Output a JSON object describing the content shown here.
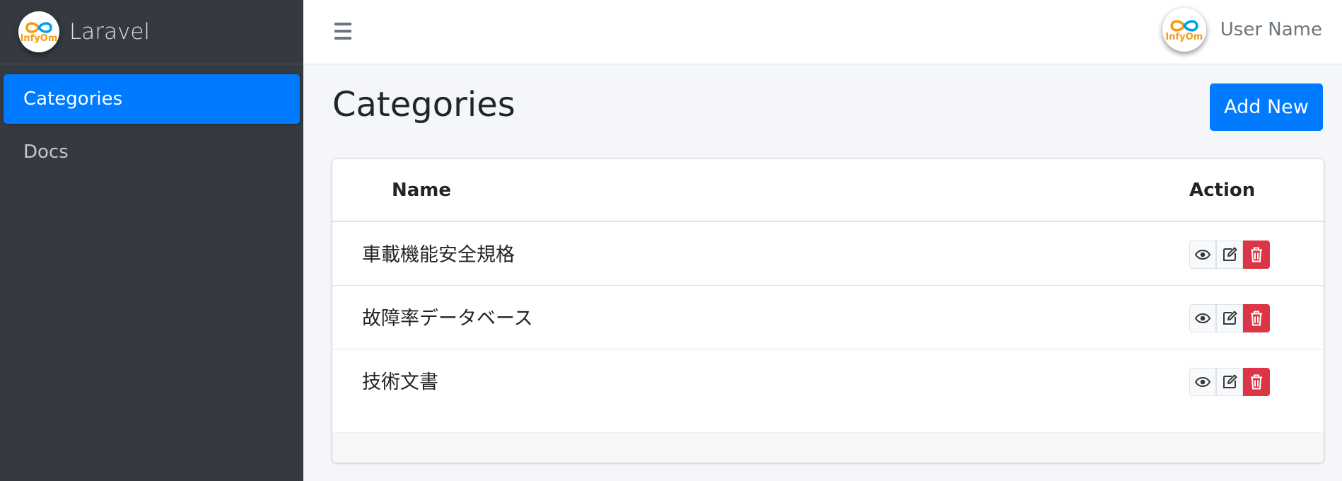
{
  "brand": {
    "name": "Laravel",
    "logo_text": "InfyOm"
  },
  "sidebar": {
    "items": [
      {
        "label": "Categories",
        "active": true
      },
      {
        "label": "Docs",
        "active": false
      }
    ]
  },
  "topbar": {
    "menu_icon": "hamburger-icon",
    "user": {
      "name": "User Name",
      "avatar_text": "InfyOm"
    }
  },
  "page": {
    "title": "Categories",
    "add_button_label": "Add New"
  },
  "table": {
    "columns": [
      "Name",
      "Action"
    ],
    "rows": [
      {
        "name": "車載機能安全規格"
      },
      {
        "name": "故障率データベース"
      },
      {
        "name": "技術文書"
      }
    ],
    "action_icons": [
      "eye-icon",
      "edit-icon",
      "trash-icon"
    ]
  },
  "colors": {
    "primary": "#007bff",
    "danger": "#dc3545",
    "sidebar": "#343a40",
    "logo_blue": "#00a0e9",
    "logo_orange": "#f39c12"
  }
}
